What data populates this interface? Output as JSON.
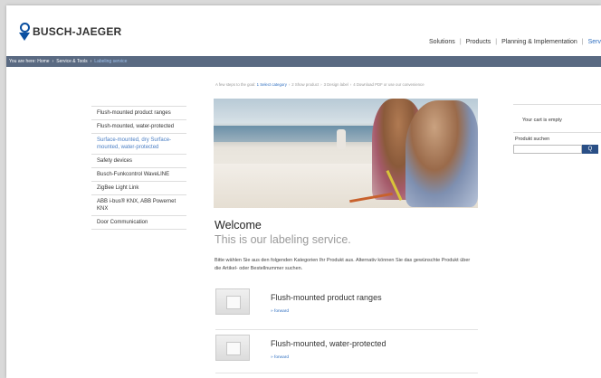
{
  "header": {
    "logo_text": "BUSCH-JAEGER",
    "nav": [
      "Solutions",
      "Products",
      "Planning & Implementation",
      "Serv"
    ]
  },
  "breadcrumb": {
    "prefix": "You are here:",
    "items": [
      "Home",
      "Service & Tools",
      "Labeling service"
    ]
  },
  "steps": {
    "intro": "A few steps to the goal:",
    "items": [
      "1 Select category",
      "2 Show product",
      "3 Design label",
      "4 Download PDF or use our convenience"
    ]
  },
  "sidebar": {
    "items": [
      {
        "label": "Flush-mounted product ranges",
        "active": false
      },
      {
        "label": "Flush-mounted, water-protected",
        "active": false
      },
      {
        "label": "Surface-mounted, dry Surface-mounted, water-protected",
        "active": true
      },
      {
        "label": "Safety devices",
        "active": false
      },
      {
        "label": "Busch-Funkcontrol WaveLINE",
        "active": false
      },
      {
        "label": "ZigBee Light Link",
        "active": false
      },
      {
        "label": "ABB i-bus® KNX, ABB Powernet KNX",
        "active": false
      },
      {
        "label": "Door Communication",
        "active": false
      }
    ]
  },
  "main": {
    "welcome": "Welcome",
    "subtitle": "This is our labeling service.",
    "intro": "Bitte wählen Sie aus den folgenden Kategorien Ihr Produkt aus. Alternativ können Sie das gewünschte Produkt über die Artikel- oder Bestellnummer suchen.",
    "products": [
      {
        "title": "Flush-mounted product ranges",
        "link": "» forward"
      },
      {
        "title": "Flush-mounted, water-protected",
        "link": "» forward"
      }
    ]
  },
  "cart": {
    "empty_text": "Your cart is empty",
    "search_label": "Produkt suchen",
    "search_placeholder": "",
    "search_button": "Q"
  },
  "colors": {
    "brand_blue": "#0a4fa0",
    "crumb_bar": "#5a6a82",
    "link_blue": "#2f6fc0",
    "search_button": "#2a4f86"
  }
}
